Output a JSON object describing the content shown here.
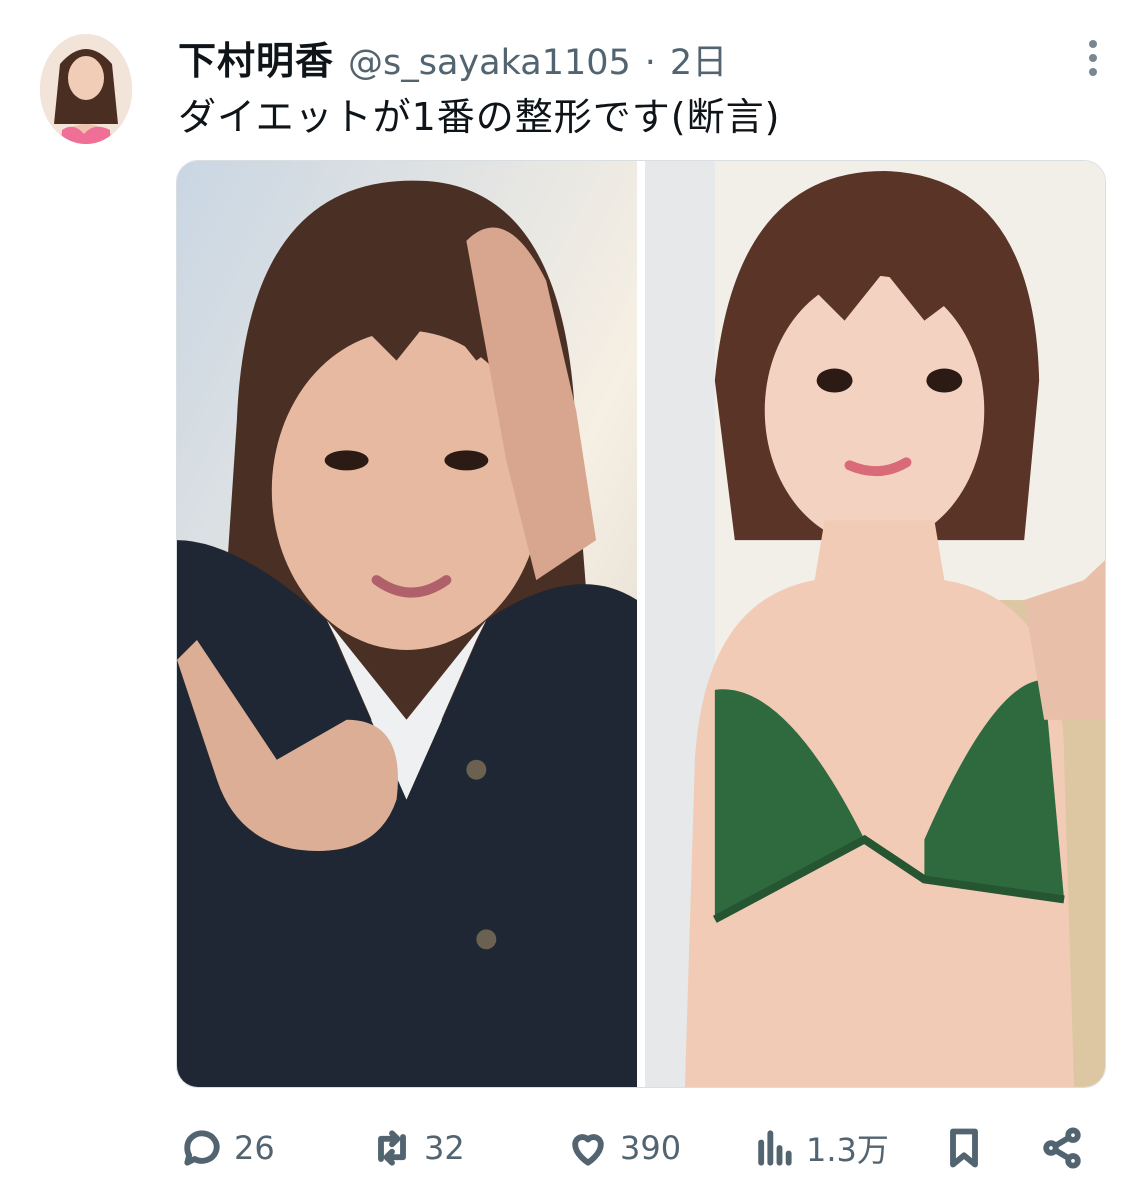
{
  "tweet": {
    "display_name": "下村明香",
    "handle": "@s_sayaka1105",
    "separator": "·",
    "time": "2日",
    "text": "ダイエットが1番の整形です(断言)"
  },
  "media": {
    "photos": [
      {
        "name": "before-photo"
      },
      {
        "name": "after-photo"
      }
    ]
  },
  "actions": {
    "replies": "26",
    "retweets": "32",
    "likes": "390",
    "views": "1.3万"
  },
  "icons": {
    "more": "more-vertical-icon",
    "reply": "reply-bubble-icon",
    "retweet": "retweet-icon",
    "like": "heart-icon",
    "views": "views-chart-icon",
    "bookmark": "bookmark-icon",
    "share": "share-icon"
  },
  "colors": {
    "text": "#0f1419",
    "secondary": "#536471",
    "border": "#d9dee2"
  }
}
